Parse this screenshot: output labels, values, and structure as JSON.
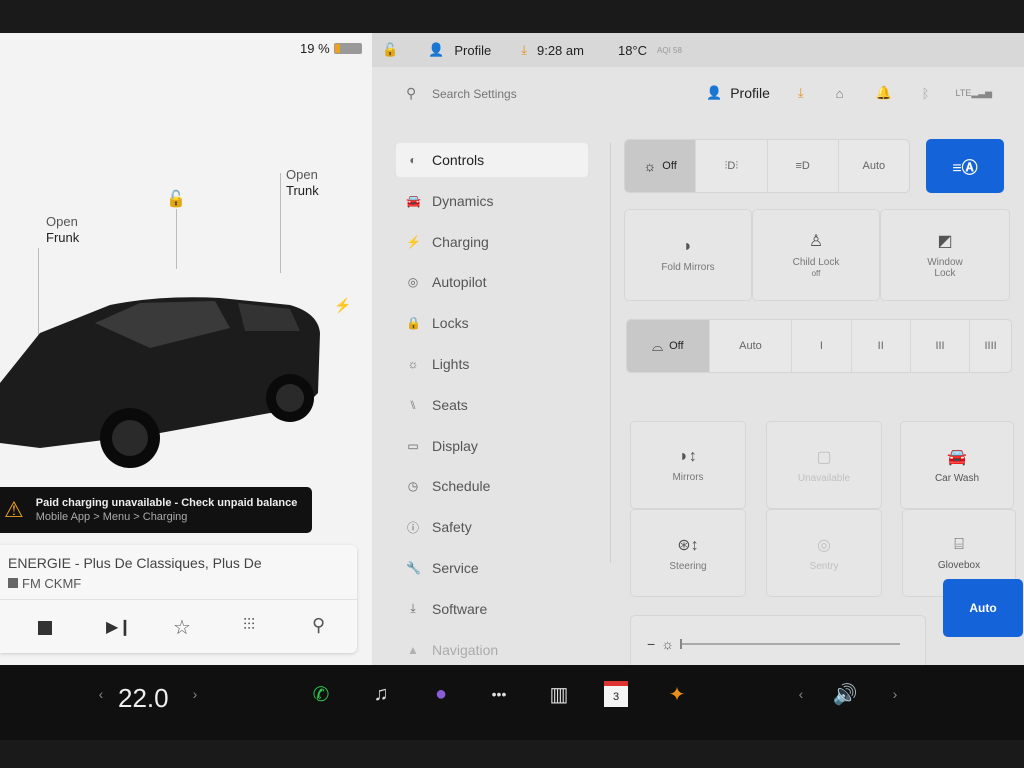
{
  "status_bar": {
    "battery": "19 %",
    "profile": "Profile",
    "time": "9:28 am",
    "temperature": "18°C",
    "aqi": "AQI 58"
  },
  "car": {
    "frunk_line1": "Open",
    "frunk_line2": "Frunk",
    "trunk_line1": "Open",
    "trunk_line2": "Trunk"
  },
  "alert": {
    "title": "Paid charging unavailable - Check unpaid balance",
    "subtitle": "Mobile App > Menu > Charging",
    "icon": "warning-icon",
    "color": "#f0a020"
  },
  "media": {
    "title": "ENERGIE - Plus De Classiques, Plus De",
    "station": "FM CKMF"
  },
  "header": {
    "search_placeholder": "Search Settings",
    "profile": "Profile"
  },
  "menu": [
    {
      "label": "Controls",
      "icon": "toggle-icon",
      "glyph": "◐"
    },
    {
      "label": "Dynamics",
      "icon": "car-icon",
      "glyph": "🚘"
    },
    {
      "label": "Charging",
      "icon": "bolt-icon",
      "glyph": "⚡"
    },
    {
      "label": "Autopilot",
      "icon": "steering-wheel-icon",
      "glyph": "◎"
    },
    {
      "label": "Locks",
      "icon": "lock-icon",
      "glyph": "🔒"
    },
    {
      "label": "Lights",
      "icon": "light-icon",
      "glyph": "☼"
    },
    {
      "label": "Seats",
      "icon": "seat-icon",
      "glyph": "⑊"
    },
    {
      "label": "Display",
      "icon": "display-icon",
      "glyph": "▭"
    },
    {
      "label": "Schedule",
      "icon": "clock-icon",
      "glyph": "◷"
    },
    {
      "label": "Safety",
      "icon": "safety-icon",
      "glyph": "ⓘ"
    },
    {
      "label": "Service",
      "icon": "wrench-icon",
      "glyph": "🔧"
    },
    {
      "label": "Software",
      "icon": "download-icon",
      "glyph": "⤓"
    },
    {
      "label": "Navigation",
      "icon": "navigation-icon",
      "glyph": "▲"
    }
  ],
  "controls": {
    "lights": {
      "off": "Off",
      "auto": "Auto",
      "selected": "Off"
    },
    "fold_mirrors": "Fold Mirrors",
    "child_lock": "Child Lock",
    "child_lock_state": "off",
    "window_lock_1": "Window",
    "window_lock_2": "Lock",
    "wipers": {
      "off": "Off",
      "auto": "Auto",
      "s1": "I",
      "s2": "II",
      "s3": "III",
      "s4": "IIII",
      "selected": "Off"
    },
    "mirrors": "Mirrors",
    "unavailable": "Unavailable",
    "car_wash": "Car Wash",
    "steering": "Steering",
    "sentry": "Sentry",
    "glovebox": "Glovebox",
    "brightness_auto": "Auto",
    "brightness_level": 0.0,
    "accent": "#1463d8"
  },
  "taskbar": {
    "temperature": "22.0",
    "calendar_day": "3"
  }
}
